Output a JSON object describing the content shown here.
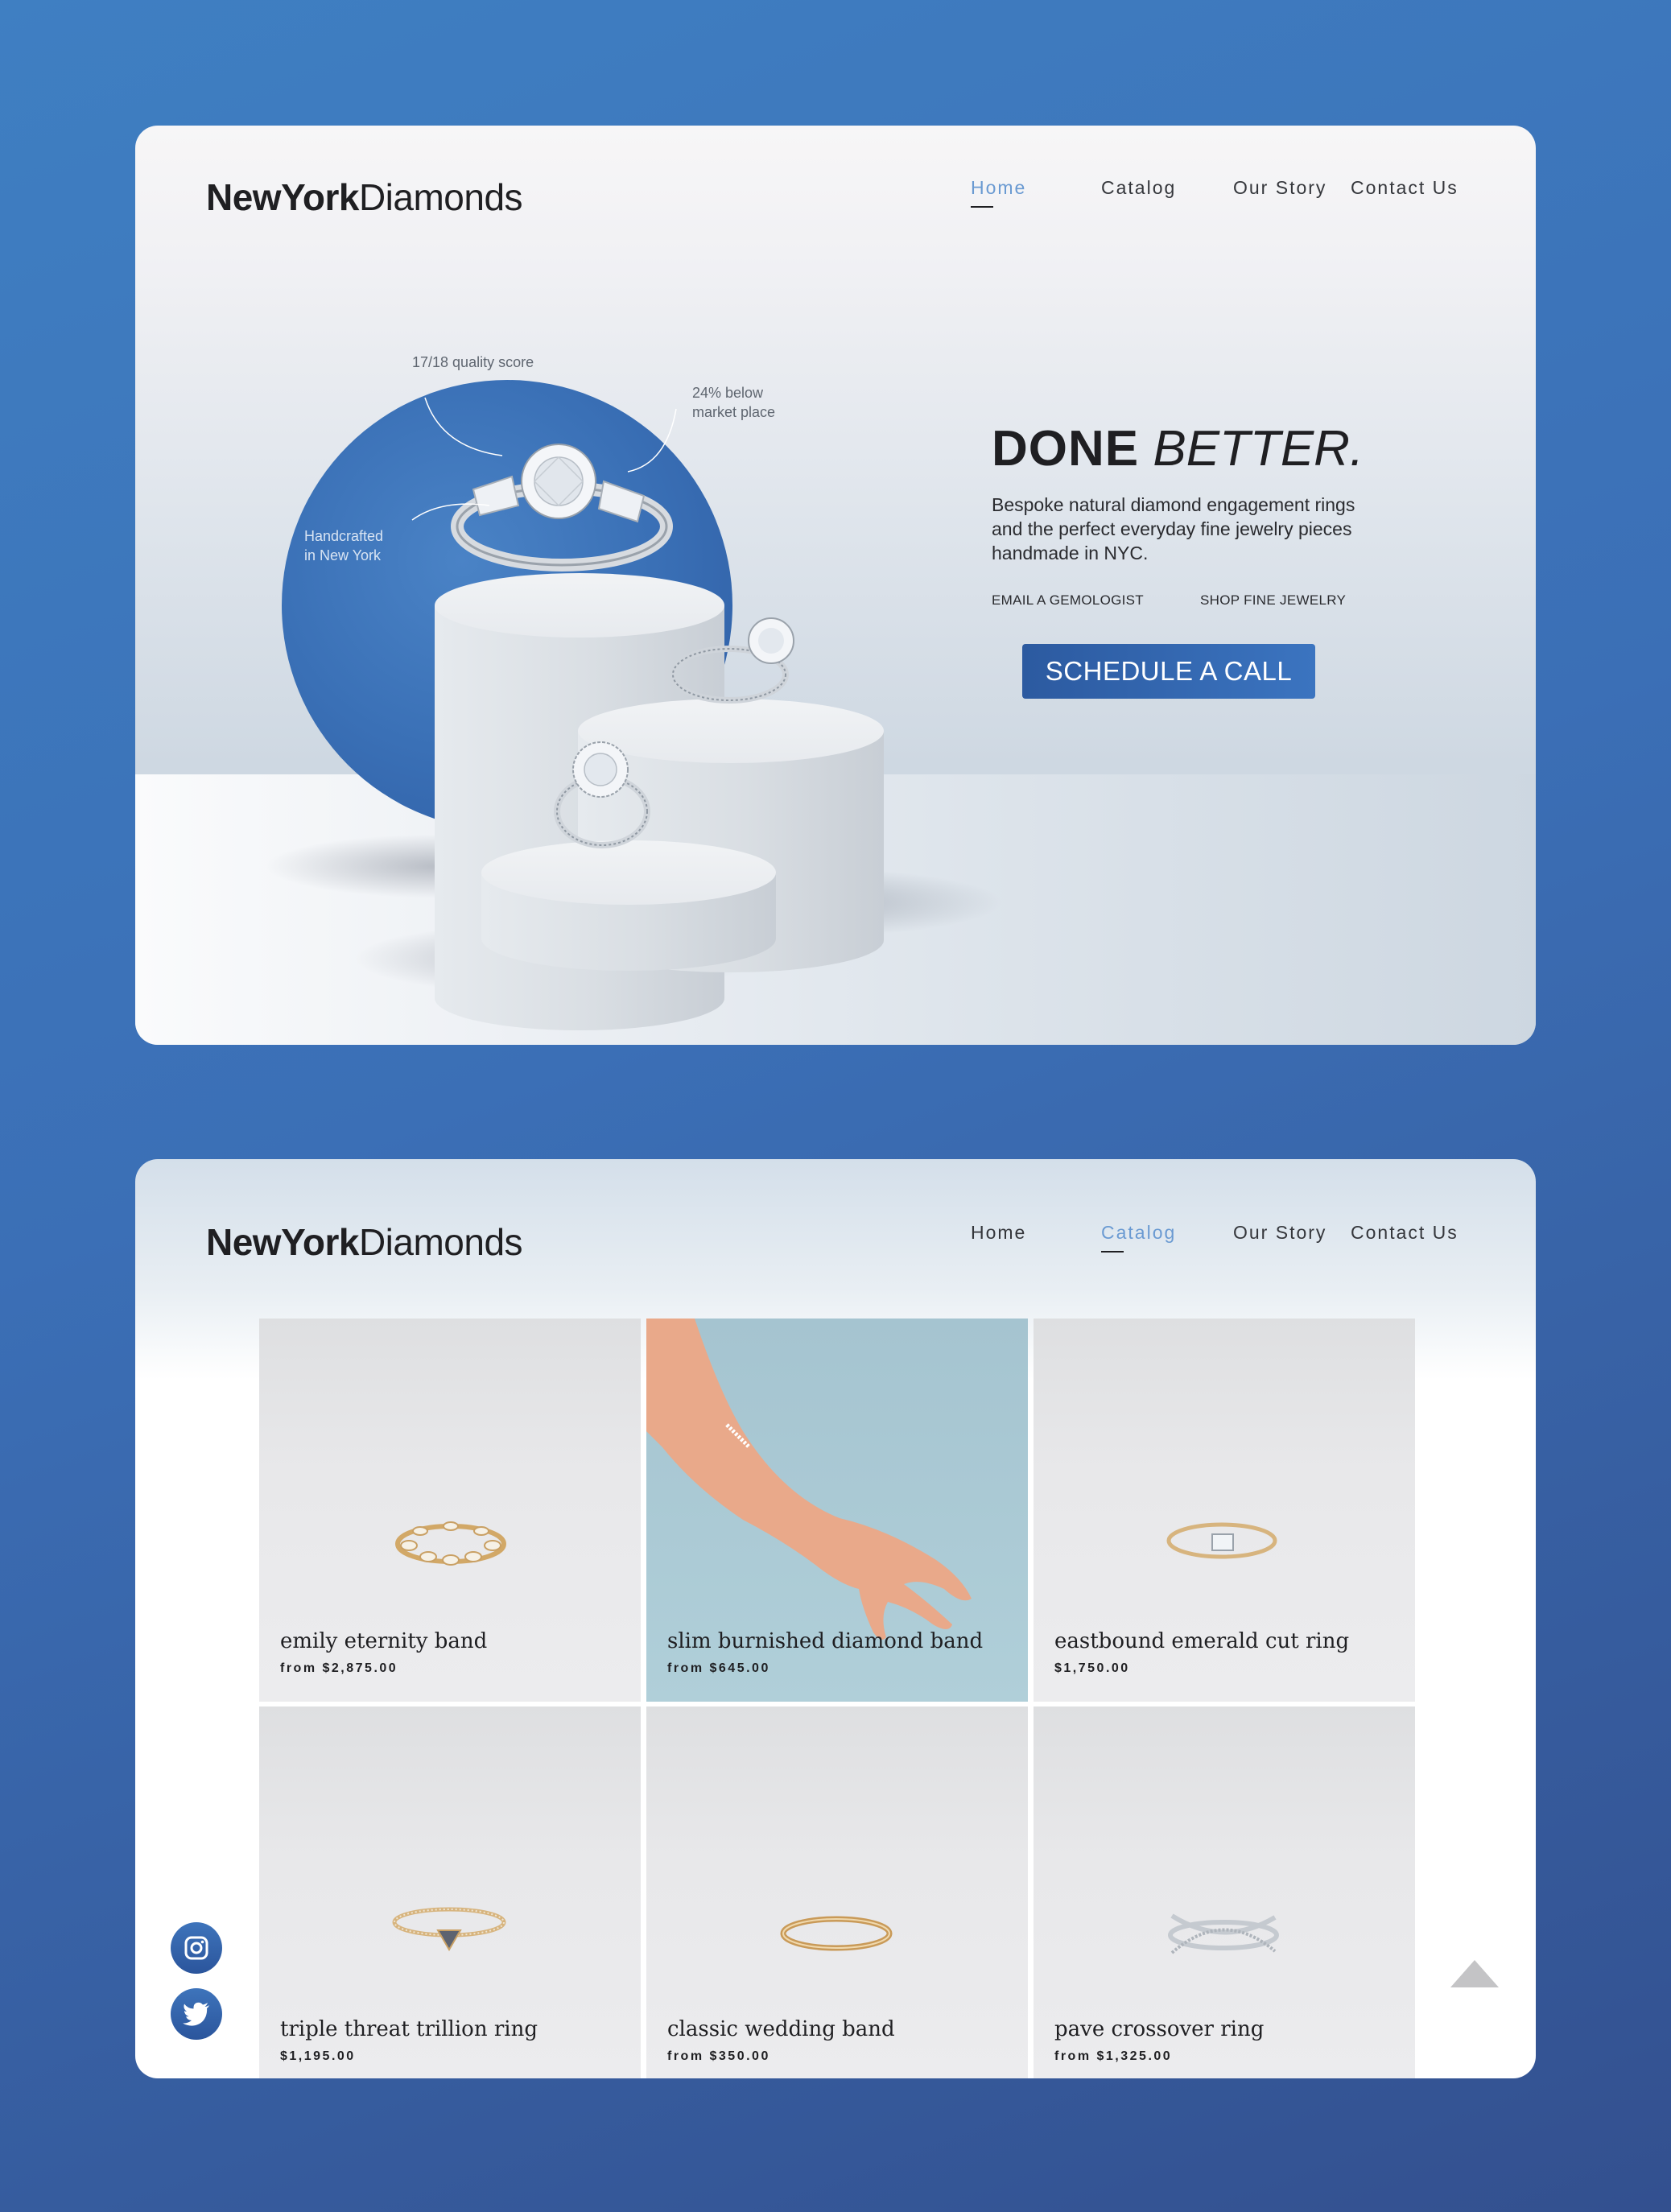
{
  "brand": {
    "name_bold": "NewYork",
    "name_light": "Diamonds"
  },
  "hero_page": {
    "nav": [
      {
        "label": "Home",
        "active": true
      },
      {
        "label": "Catalog",
        "active": false
      },
      {
        "label": "Our Story",
        "active": false
      },
      {
        "label": "Contact Us",
        "active": false
      }
    ],
    "callouts": {
      "quality": "17/18 quality score",
      "price_line1": "24% below",
      "price_line2": "market place",
      "craft_line1": "Handcrafted",
      "craft_line2": "in New York"
    },
    "headline_bold": "DONE",
    "headline_italic": "BETTER.",
    "tagline": "Bespoke natural diamond engagement rings and the perfect everyday fine jewelry pieces handmade in NYC.",
    "links": {
      "email": "EMAIL A GEMOLOGIST",
      "shop": "SHOP FINE JEWELRY"
    },
    "cta": "SCHEDULE A CALL"
  },
  "catalog_page": {
    "nav": [
      {
        "label": "Home",
        "active": false
      },
      {
        "label": "Catalog",
        "active": true
      },
      {
        "label": "Our Story",
        "active": false
      },
      {
        "label": "Contact Us",
        "active": false
      }
    ],
    "products": [
      {
        "name": "emily eternity band",
        "price": "from $2,875.00"
      },
      {
        "name": "slim burnished diamond band",
        "price": "from $645.00"
      },
      {
        "name": "eastbound emerald cut ring",
        "price": "$1,750.00"
      },
      {
        "name": "triple threat trillion ring",
        "price": "$1,195.00"
      },
      {
        "name": "classic wedding band",
        "price": "from $350.00"
      },
      {
        "name": "pave crossover ring",
        "price": "from $1,325.00"
      }
    ],
    "social": [
      "instagram-icon",
      "twitter-icon"
    ],
    "colors": {
      "accent": "#3b74c0",
      "nav_active": "#6a9ad2",
      "tile_blue": "#acc9d4"
    }
  }
}
